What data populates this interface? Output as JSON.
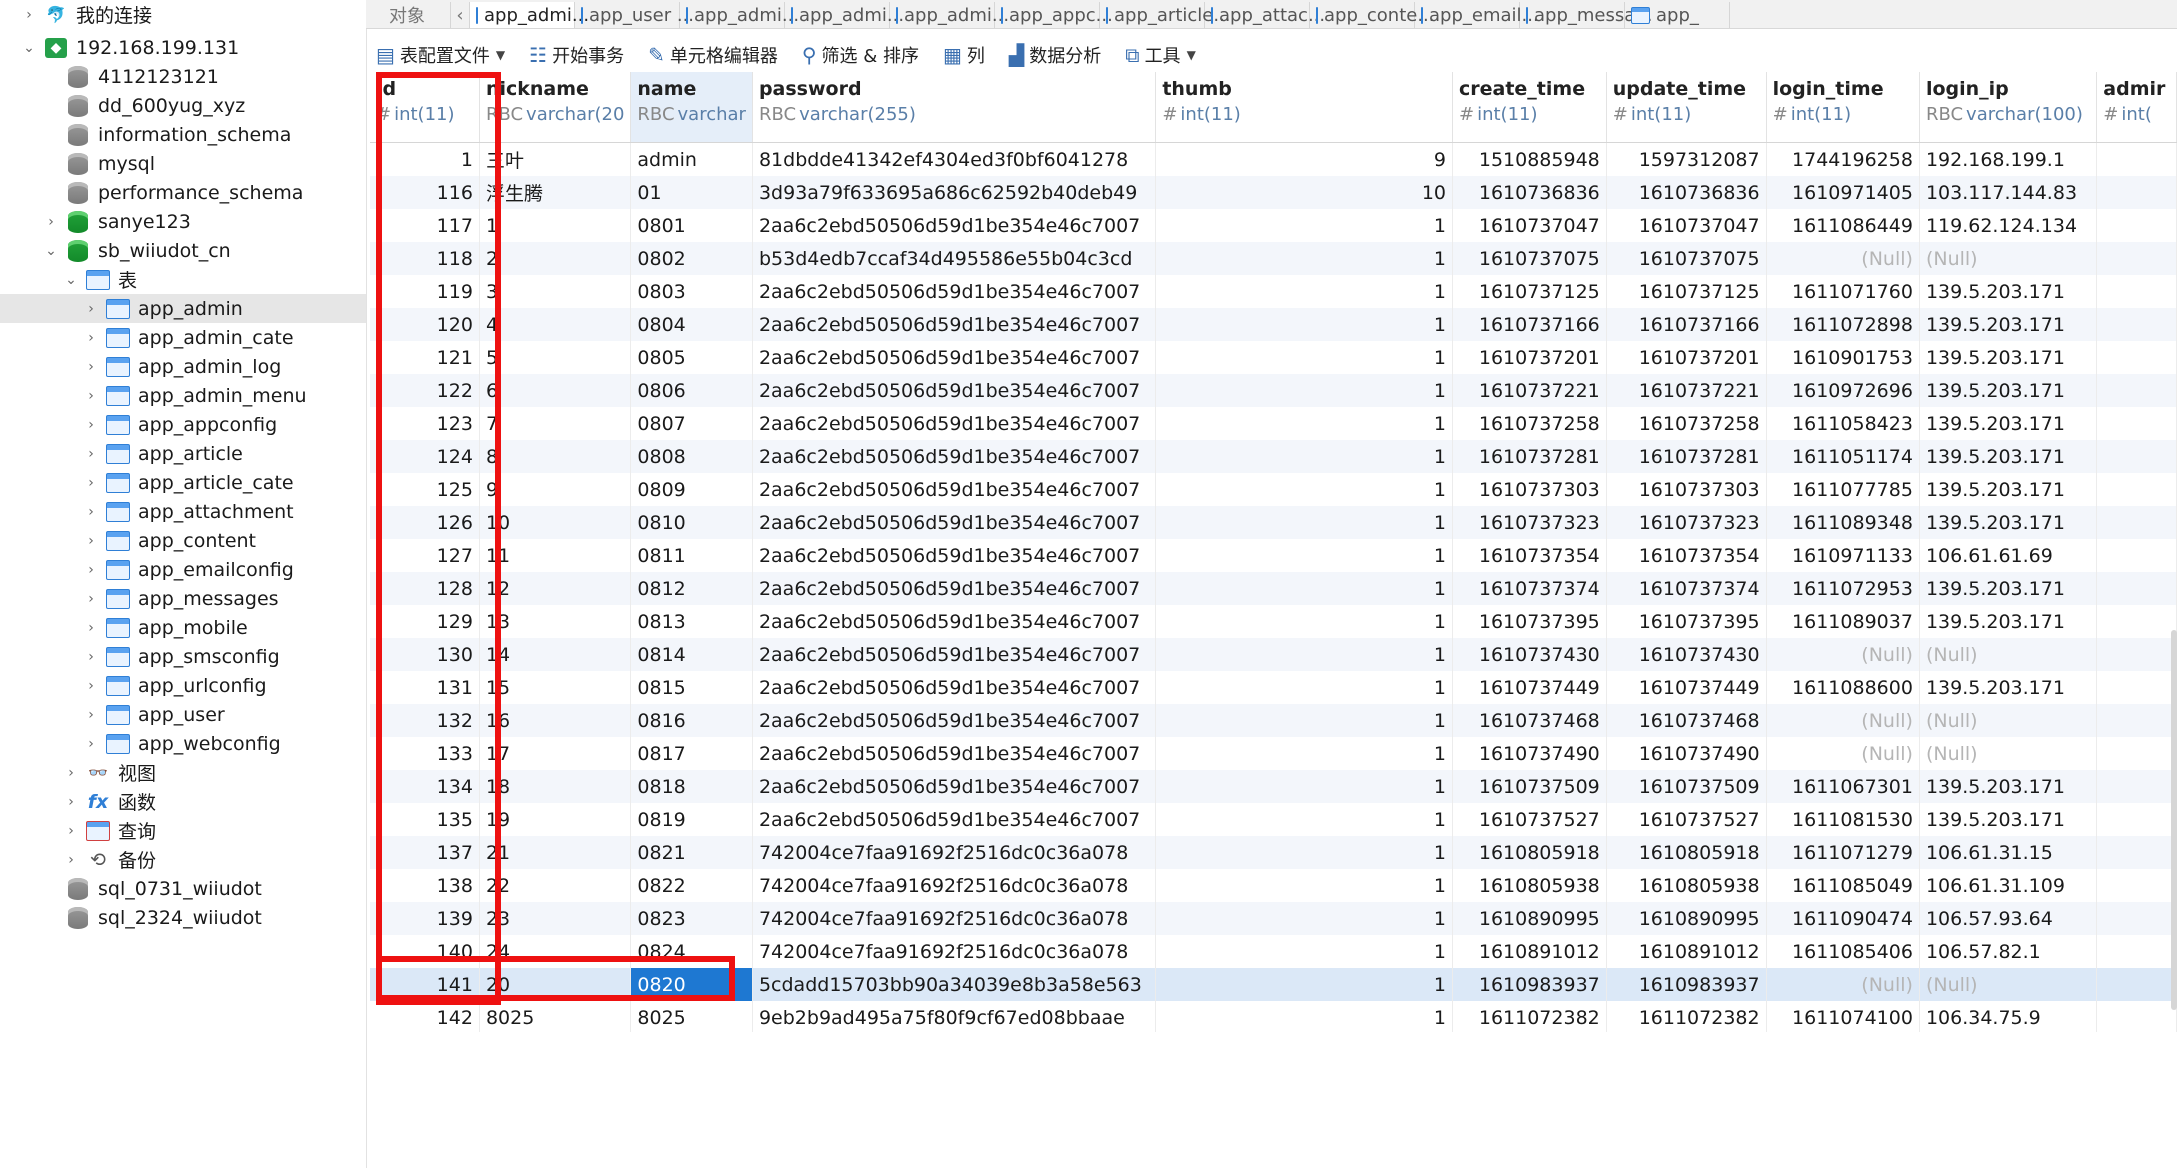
{
  "sidebar": {
    "items": [
      {
        "label": "我的连接",
        "icon": "connections-icon",
        "level": 0,
        "expanded": false
      },
      {
        "label": "192.168.199.131",
        "icon": "mysql-connection-icon",
        "level": 0,
        "expanded": true
      },
      {
        "label": "4112123121",
        "icon": "database-icon",
        "level": 1
      },
      {
        "label": "dd_600yug_xyz",
        "icon": "database-icon",
        "level": 1
      },
      {
        "label": "information_schema",
        "icon": "database-icon",
        "level": 1
      },
      {
        "label": "mysql",
        "icon": "database-icon",
        "level": 1
      },
      {
        "label": "performance_schema",
        "icon": "database-icon",
        "level": 1
      },
      {
        "label": "sanye123",
        "icon": "database-open-icon",
        "level": 1,
        "expanded": false
      },
      {
        "label": "sb_wiiudot_cn",
        "icon": "database-open-icon",
        "level": 1,
        "expanded": true
      },
      {
        "label": "表",
        "icon": "tables-folder-icon",
        "level": 2,
        "expanded": true
      },
      {
        "label": "app_admin",
        "icon": "table-icon",
        "level": 3,
        "selected": true
      },
      {
        "label": "app_admin_cate",
        "icon": "table-icon",
        "level": 3
      },
      {
        "label": "app_admin_log",
        "icon": "table-icon",
        "level": 3
      },
      {
        "label": "app_admin_menu",
        "icon": "table-icon",
        "level": 3
      },
      {
        "label": "app_appconfig",
        "icon": "table-icon",
        "level": 3
      },
      {
        "label": "app_article",
        "icon": "table-icon",
        "level": 3
      },
      {
        "label": "app_article_cate",
        "icon": "table-icon",
        "level": 3
      },
      {
        "label": "app_attachment",
        "icon": "table-icon",
        "level": 3
      },
      {
        "label": "app_content",
        "icon": "table-icon",
        "level": 3
      },
      {
        "label": "app_emailconfig",
        "icon": "table-icon",
        "level": 3
      },
      {
        "label": "app_messages",
        "icon": "table-icon",
        "level": 3
      },
      {
        "label": "app_mobile",
        "icon": "table-icon",
        "level": 3
      },
      {
        "label": "app_smsconfig",
        "icon": "table-icon",
        "level": 3
      },
      {
        "label": "app_urlconfig",
        "icon": "table-icon",
        "level": 3
      },
      {
        "label": "app_user",
        "icon": "table-icon",
        "level": 3
      },
      {
        "label": "app_webconfig",
        "icon": "table-icon",
        "level": 3
      },
      {
        "label": "视图",
        "icon": "views-icon",
        "level": 2
      },
      {
        "label": "函数",
        "icon": "functions-icon",
        "level": 2
      },
      {
        "label": "查询",
        "icon": "queries-icon",
        "level": 2
      },
      {
        "label": "备份",
        "icon": "backup-icon",
        "level": 2
      },
      {
        "label": "sql_0731_wiiudot",
        "icon": "database-icon",
        "level": 1
      },
      {
        "label": "sql_2324_wiiudot",
        "icon": "database-icon",
        "level": 1
      }
    ]
  },
  "tabs": [
    {
      "label": "对象",
      "kind": "objects"
    },
    {
      "label": "‹",
      "kind": "nav"
    },
    {
      "label": "app_admi...",
      "active": true
    },
    {
      "label": "app_user ..."
    },
    {
      "label": "app_admi..."
    },
    {
      "label": "app_admi..."
    },
    {
      "label": "app_admi..."
    },
    {
      "label": "app_appc..."
    },
    {
      "label": "app_article..."
    },
    {
      "label": "app_attac..."
    },
    {
      "label": "app_conte..."
    },
    {
      "label": "app_email..."
    },
    {
      "label": "app_messa..."
    },
    {
      "label": "app_"
    }
  ],
  "toolbar": {
    "profile_label": "表配置文件",
    "begin_tx_label": "开始事务",
    "cell_editor_label": "单元格编辑器",
    "filter_sort_label": "筛选 & 排序",
    "columns_label": "列",
    "data_analysis_label": "数据分析",
    "tools_label": "工具"
  },
  "grid": {
    "columns": [
      {
        "name": "id",
        "type": "int(11)",
        "sym": "#",
        "align": "num"
      },
      {
        "name": "nickname",
        "type": "varchar(20",
        "sym": "RBC",
        "align": "text"
      },
      {
        "name": "name",
        "type": "varchar",
        "sym": "RBC",
        "align": "text",
        "selected": true
      },
      {
        "name": "password",
        "type": "varchar(255)",
        "sym": "RBC",
        "align": "text"
      },
      {
        "name": "thumb",
        "type": "int(11)",
        "sym": "#",
        "align": "num"
      },
      {
        "name": "create_time",
        "type": "int(11)",
        "sym": "#",
        "align": "num"
      },
      {
        "name": "update_time",
        "type": "int(11)",
        "sym": "#",
        "align": "num"
      },
      {
        "name": "login_time",
        "type": "int(11)",
        "sym": "#",
        "align": "num"
      },
      {
        "name": "login_ip",
        "type": "varchar(100)",
        "sym": "RBC",
        "align": "text"
      },
      {
        "name": "admir",
        "type": "int(",
        "sym": "#",
        "align": "num"
      }
    ],
    "rows": [
      [
        "1",
        "三叶",
        "admin",
        "81dbdde41342ef4304ed3f0bf6041278",
        "9",
        "1510885948",
        "1597312087",
        "1744196258",
        "192.168.199.1",
        ""
      ],
      [
        "116",
        "浮生腾",
        "01",
        "3d93a79f633695a686c62592b40deb49",
        "10",
        "1610736836",
        "1610736836",
        "1610971405",
        "103.117.144.83",
        ""
      ],
      [
        "117",
        "1",
        "0801",
        "2aa6c2ebd50506d59d1be354e46c7007",
        "1",
        "1610737047",
        "1610737047",
        "1611086449",
        "119.62.124.134",
        ""
      ],
      [
        "118",
        "2",
        "0802",
        "b53d4edb7ccaf34d495586e55b04c3cd",
        "1",
        "1610737075",
        "1610737075",
        "(Null)",
        "(Null)",
        ""
      ],
      [
        "119",
        "3",
        "0803",
        "2aa6c2ebd50506d59d1be354e46c7007",
        "1",
        "1610737125",
        "1610737125",
        "1611071760",
        "139.5.203.171",
        ""
      ],
      [
        "120",
        "4",
        "0804",
        "2aa6c2ebd50506d59d1be354e46c7007",
        "1",
        "1610737166",
        "1610737166",
        "1611072898",
        "139.5.203.171",
        ""
      ],
      [
        "121",
        "5",
        "0805",
        "2aa6c2ebd50506d59d1be354e46c7007",
        "1",
        "1610737201",
        "1610737201",
        "1610901753",
        "139.5.203.171",
        ""
      ],
      [
        "122",
        "6",
        "0806",
        "2aa6c2ebd50506d59d1be354e46c7007",
        "1",
        "1610737221",
        "1610737221",
        "1610972696",
        "139.5.203.171",
        ""
      ],
      [
        "123",
        "7",
        "0807",
        "2aa6c2ebd50506d59d1be354e46c7007",
        "1",
        "1610737258",
        "1610737258",
        "1611058423",
        "139.5.203.171",
        ""
      ],
      [
        "124",
        "8",
        "0808",
        "2aa6c2ebd50506d59d1be354e46c7007",
        "1",
        "1610737281",
        "1610737281",
        "1611051174",
        "139.5.203.171",
        ""
      ],
      [
        "125",
        "9",
        "0809",
        "2aa6c2ebd50506d59d1be354e46c7007",
        "1",
        "1610737303",
        "1610737303",
        "1611077785",
        "139.5.203.171",
        ""
      ],
      [
        "126",
        "10",
        "0810",
        "2aa6c2ebd50506d59d1be354e46c7007",
        "1",
        "1610737323",
        "1610737323",
        "1611089348",
        "139.5.203.171",
        ""
      ],
      [
        "127",
        "11",
        "0811",
        "2aa6c2ebd50506d59d1be354e46c7007",
        "1",
        "1610737354",
        "1610737354",
        "1610971133",
        "106.61.61.69",
        ""
      ],
      [
        "128",
        "12",
        "0812",
        "2aa6c2ebd50506d59d1be354e46c7007",
        "1",
        "1610737374",
        "1610737374",
        "1611072953",
        "139.5.203.171",
        ""
      ],
      [
        "129",
        "13",
        "0813",
        "2aa6c2ebd50506d59d1be354e46c7007",
        "1",
        "1610737395",
        "1610737395",
        "1611089037",
        "139.5.203.171",
        ""
      ],
      [
        "130",
        "14",
        "0814",
        "2aa6c2ebd50506d59d1be354e46c7007",
        "1",
        "1610737430",
        "1610737430",
        "(Null)",
        "(Null)",
        ""
      ],
      [
        "131",
        "15",
        "0815",
        "2aa6c2ebd50506d59d1be354e46c7007",
        "1",
        "1610737449",
        "1610737449",
        "1611088600",
        "139.5.203.171",
        ""
      ],
      [
        "132",
        "16",
        "0816",
        "2aa6c2ebd50506d59d1be354e46c7007",
        "1",
        "1610737468",
        "1610737468",
        "(Null)",
        "(Null)",
        ""
      ],
      [
        "133",
        "17",
        "0817",
        "2aa6c2ebd50506d59d1be354e46c7007",
        "1",
        "1610737490",
        "1610737490",
        "(Null)",
        "(Null)",
        ""
      ],
      [
        "134",
        "18",
        "0818",
        "2aa6c2ebd50506d59d1be354e46c7007",
        "1",
        "1610737509",
        "1610737509",
        "1611067301",
        "139.5.203.171",
        ""
      ],
      [
        "135",
        "19",
        "0819",
        "2aa6c2ebd50506d59d1be354e46c7007",
        "1",
        "1610737527",
        "1610737527",
        "1611081530",
        "139.5.203.171",
        ""
      ],
      [
        "137",
        "21",
        "0821",
        "742004ce7faa91692f2516dc0c36a078",
        "1",
        "1610805918",
        "1610805918",
        "1611071279",
        "106.61.31.15",
        ""
      ],
      [
        "138",
        "22",
        "0822",
        "742004ce7faa91692f2516dc0c36a078",
        "1",
        "1610805938",
        "1610805938",
        "1611085049",
        "106.61.31.109",
        ""
      ],
      [
        "139",
        "23",
        "0823",
        "742004ce7faa91692f2516dc0c36a078",
        "1",
        "1610890995",
        "1610890995",
        "1611090474",
        "106.57.93.64",
        ""
      ],
      [
        "140",
        "24",
        "0824",
        "742004ce7faa91692f2516dc0c36a078",
        "1",
        "1610891012",
        "1610891012",
        "1611085406",
        "106.57.82.1",
        ""
      ],
      [
        "141",
        "20",
        "0820",
        "5cdadd15703bb90a34039e8b3a58e563",
        "1",
        "1610983937",
        "1610983937",
        "(Null)",
        "(Null)",
        ""
      ],
      [
        "142",
        "8025",
        "8025",
        "9eb2b9ad495a75f80f9cf67ed08bbaae",
        "1",
        "1611072382",
        "1611072382",
        "1611074100",
        "106.34.75.9",
        ""
      ]
    ],
    "selected_row_index": 25,
    "selected_column_index": 2
  },
  "colors": {
    "highlight": "#ee1111",
    "selection": "#1e78d2",
    "accent": "#2f7fd6"
  }
}
